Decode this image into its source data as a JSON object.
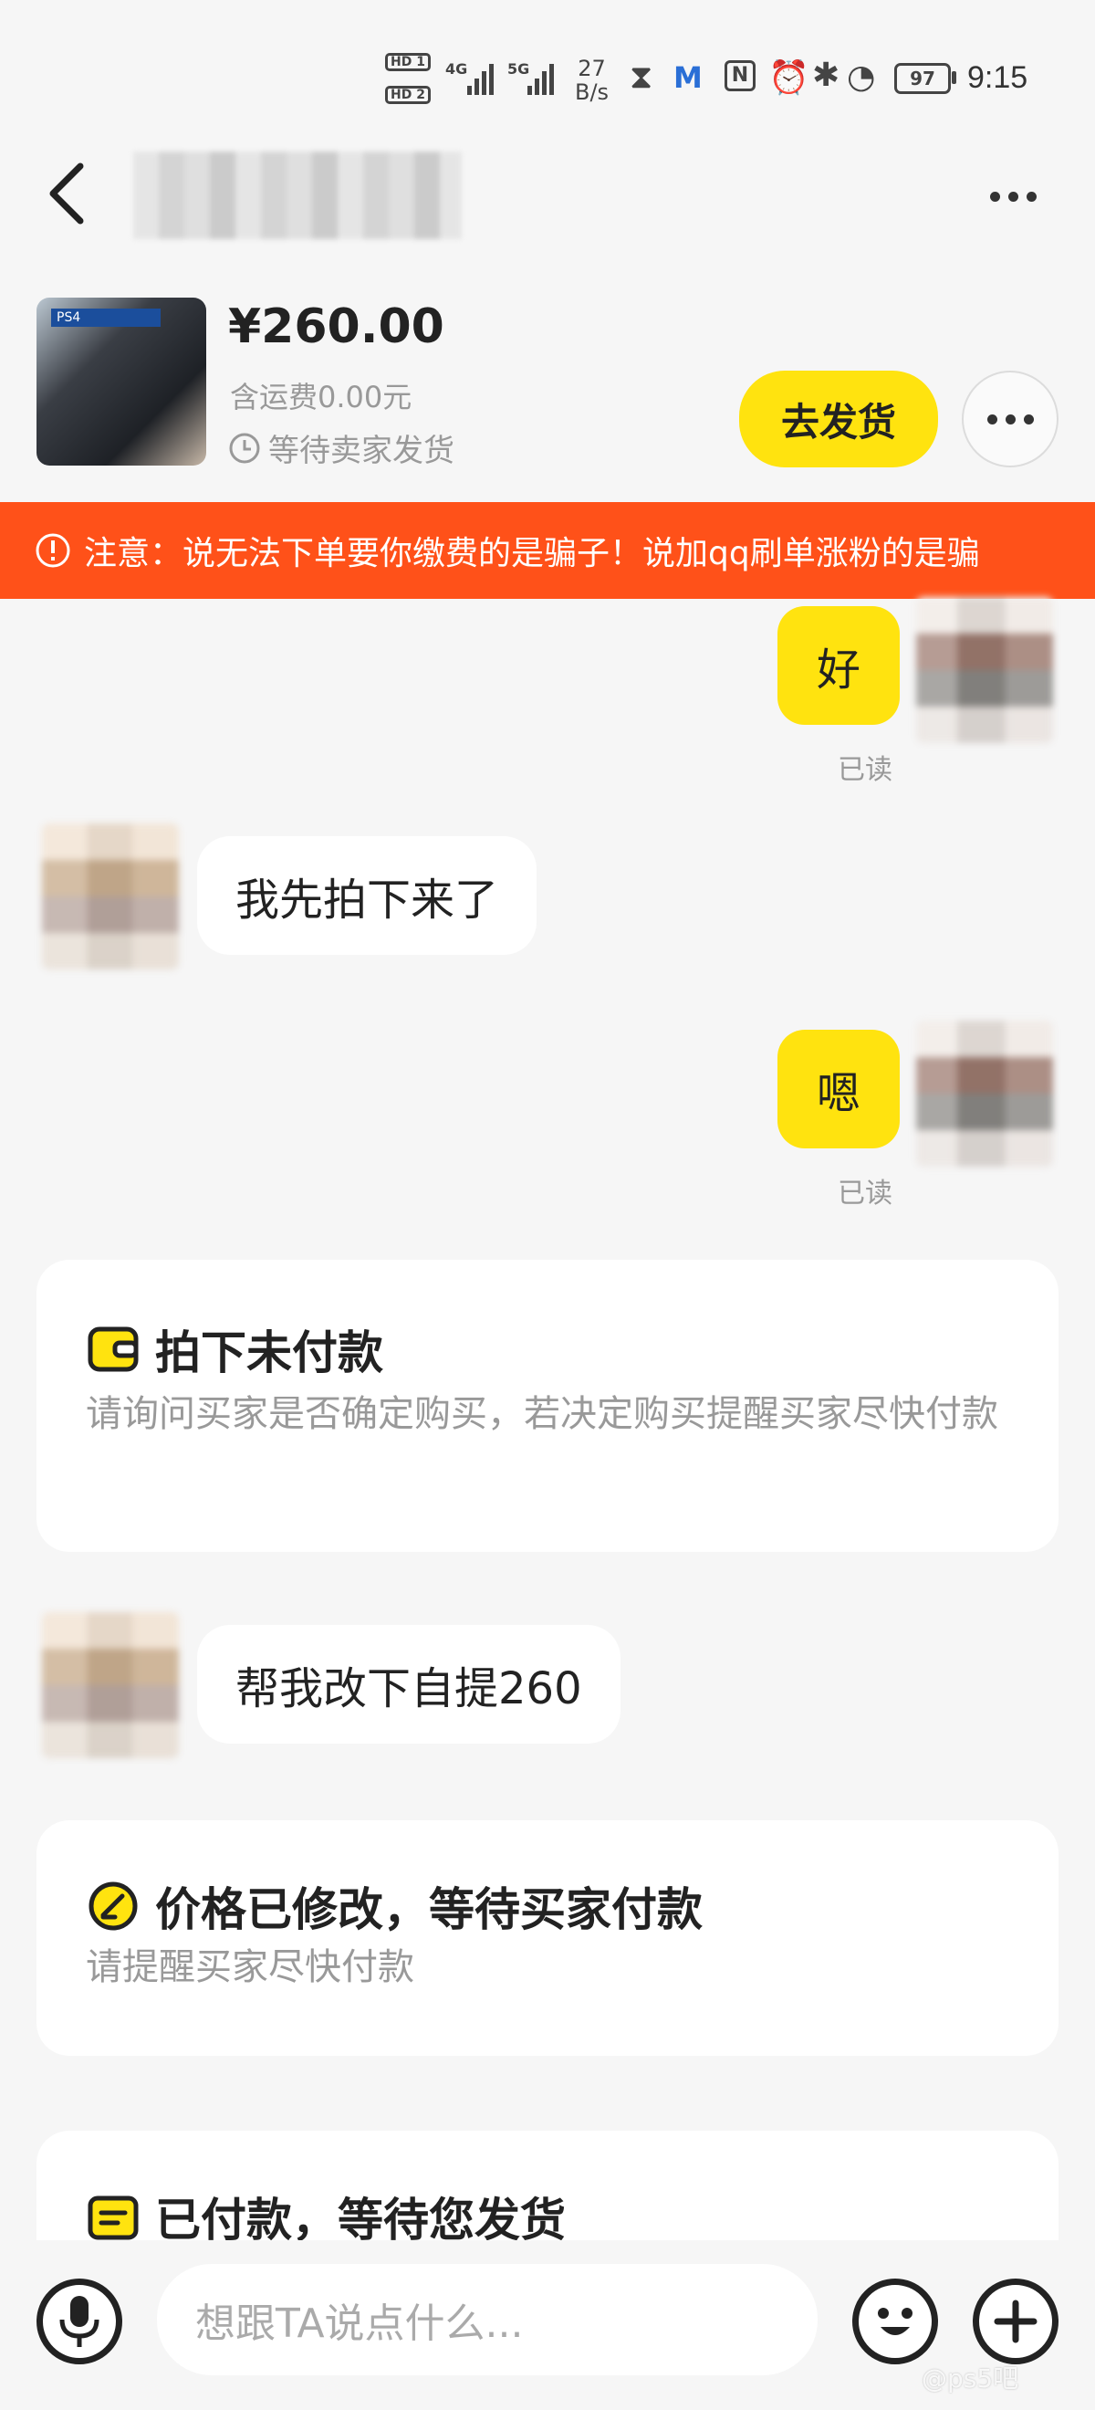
{
  "status_bar": {
    "hd1": "HD 1",
    "hd2": "HD 2",
    "net1": "4G",
    "net2": "5G",
    "speed_value": "27",
    "speed_unit": "B/s",
    "battery": "97",
    "time": "9:15"
  },
  "header": {
    "back_icon": "chevron-left-icon",
    "more_icon": "more-dots-icon"
  },
  "product": {
    "thumb_label": "PS4",
    "price": "¥260.00",
    "shipping": "含运费0.00元",
    "status": "等待卖家发货",
    "ship_button": "去发货"
  },
  "banner": {
    "text": "注意：说无法下单要你缴费的是骗子！说加qq刷单涨粉的是骗"
  },
  "messages": [
    {
      "from": "me",
      "text": "好",
      "read": "已读"
    },
    {
      "from": "them",
      "text": "我先拍下来了"
    },
    {
      "from": "me",
      "text": "嗯",
      "read": "已读"
    },
    {
      "from": "them",
      "text": "帮我改下自提260"
    }
  ],
  "cards": [
    {
      "icon": "wallet-icon",
      "title": "拍下未付款",
      "sub": "请询问买家是否确定购买，若决定购买提醒买家尽快付款"
    },
    {
      "icon": "edit-price-icon",
      "title": "价格已修改，等待买家付款",
      "sub": "请提醒买家尽快付款"
    },
    {
      "icon": "package-icon",
      "title": "已付款，等待您发货",
      "sub": ""
    }
  ],
  "input": {
    "placeholder": "想跟TA说点什么..."
  },
  "watermark": "@ps5吧",
  "colors": {
    "accent_yellow": "#ffe30f",
    "banner_orange": "#ff5119",
    "background": "#f6f6f6"
  }
}
